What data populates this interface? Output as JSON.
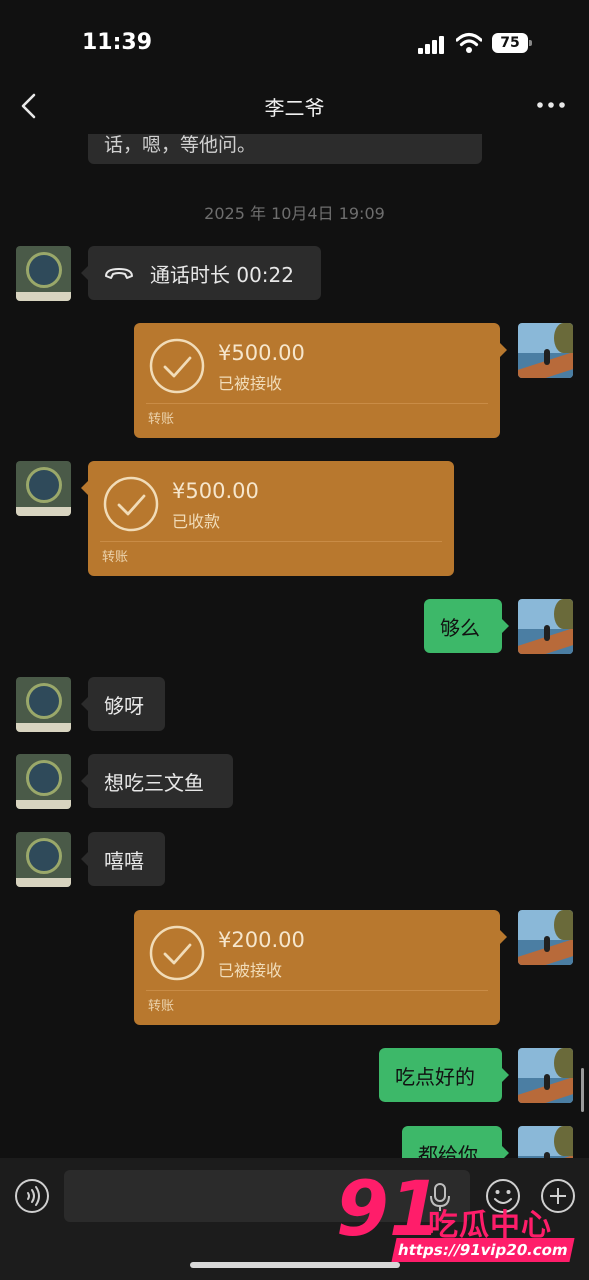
{
  "status_bar": {
    "time": "11:39",
    "battery": "75"
  },
  "header": {
    "title": "李二爷"
  },
  "chat": {
    "partial_message": "话，嗯，等他问。",
    "timestamp": "2025 年 10月4日 19:09",
    "call": {
      "text": "通话时长 00:22"
    },
    "transfers": [
      {
        "amount": "¥500.00",
        "status": "已被接收",
        "label": "转账",
        "side": "right"
      },
      {
        "amount": "¥500.00",
        "status": "已收款",
        "label": "转账",
        "side": "left"
      },
      {
        "amount": "¥200.00",
        "status": "已被接收",
        "label": "转账",
        "side": "right"
      }
    ],
    "messages": [
      {
        "text": "够么",
        "side": "right"
      },
      {
        "text": "够呀",
        "side": "left"
      },
      {
        "text": "想吃三文鱼",
        "side": "left"
      },
      {
        "text": "嘻嘻",
        "side": "left"
      },
      {
        "text": "吃点好的",
        "side": "right"
      },
      {
        "text": "都给你",
        "side": "right"
      }
    ]
  },
  "watermark": {
    "number": "91",
    "name": "吃瓜中心",
    "url": "https://91vip20.com"
  },
  "colors": {
    "background": "#111111",
    "bubble_left": "#2c2c2c",
    "bubble_right": "#3db869",
    "transfer": "#b8782e",
    "watermark": "#ff1d6a"
  },
  "icons": [
    "back-arrow",
    "more-dots",
    "phone-call",
    "check-circle",
    "voice-toggle",
    "microphone",
    "emoji",
    "plus"
  ]
}
